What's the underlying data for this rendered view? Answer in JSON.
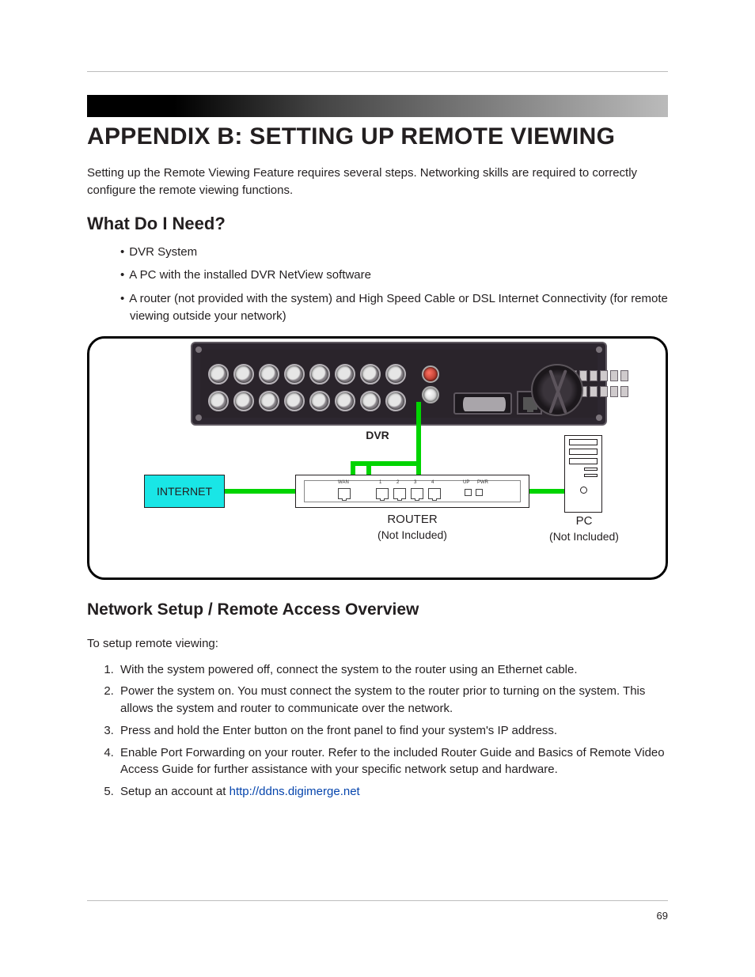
{
  "page": {
    "number": "69",
    "appendix_title": "APPENDIX B: SETTING UP REMOTE VIEWING",
    "intro": "Setting up the Remote Viewing Feature requires several steps. Networking skills are required to correctly configure the remote viewing functions."
  },
  "need": {
    "heading": "What Do I Need?",
    "items": [
      "DVR System",
      "A PC with the installed DVR NetView software",
      "A router (not provided with the system) and High Speed Cable or DSL Internet Connectivity (for remote viewing outside your network)"
    ]
  },
  "diagram": {
    "dvr_label": "DVR",
    "internet_label": "INTERNET",
    "router_label": "ROUTER",
    "router_sub": "(Not Included)",
    "pc_label": "PC",
    "pc_sub": "(Not Included)",
    "router_ports": {
      "wan": "WAN",
      "p1": "1",
      "p2": "2",
      "p3": "3",
      "p4": "4",
      "up": "UP",
      "pwr": "PWR"
    }
  },
  "overview": {
    "heading": "Network Setup / Remote Access Overview",
    "lead": "To setup remote viewing:",
    "steps": [
      "With the system powered off, connect the system to the router using an Ethernet cable.",
      "Power the system on. You must connect the system to the router prior to turning on the system. This allows the system and router to communicate over the network.",
      "Press and hold the Enter button on the front panel to find your system's IP address.",
      "Enable Port Forwarding on your router. Refer to the included Router Guide and Basics of Remote Video Access Guide for further assistance with your specific network setup and hardware."
    ],
    "step5_prefix": "Setup an account at ",
    "step5_link_text": "http://ddns.digimerge.net",
    "step5_link_href": "http://ddns.digimerge.net"
  }
}
